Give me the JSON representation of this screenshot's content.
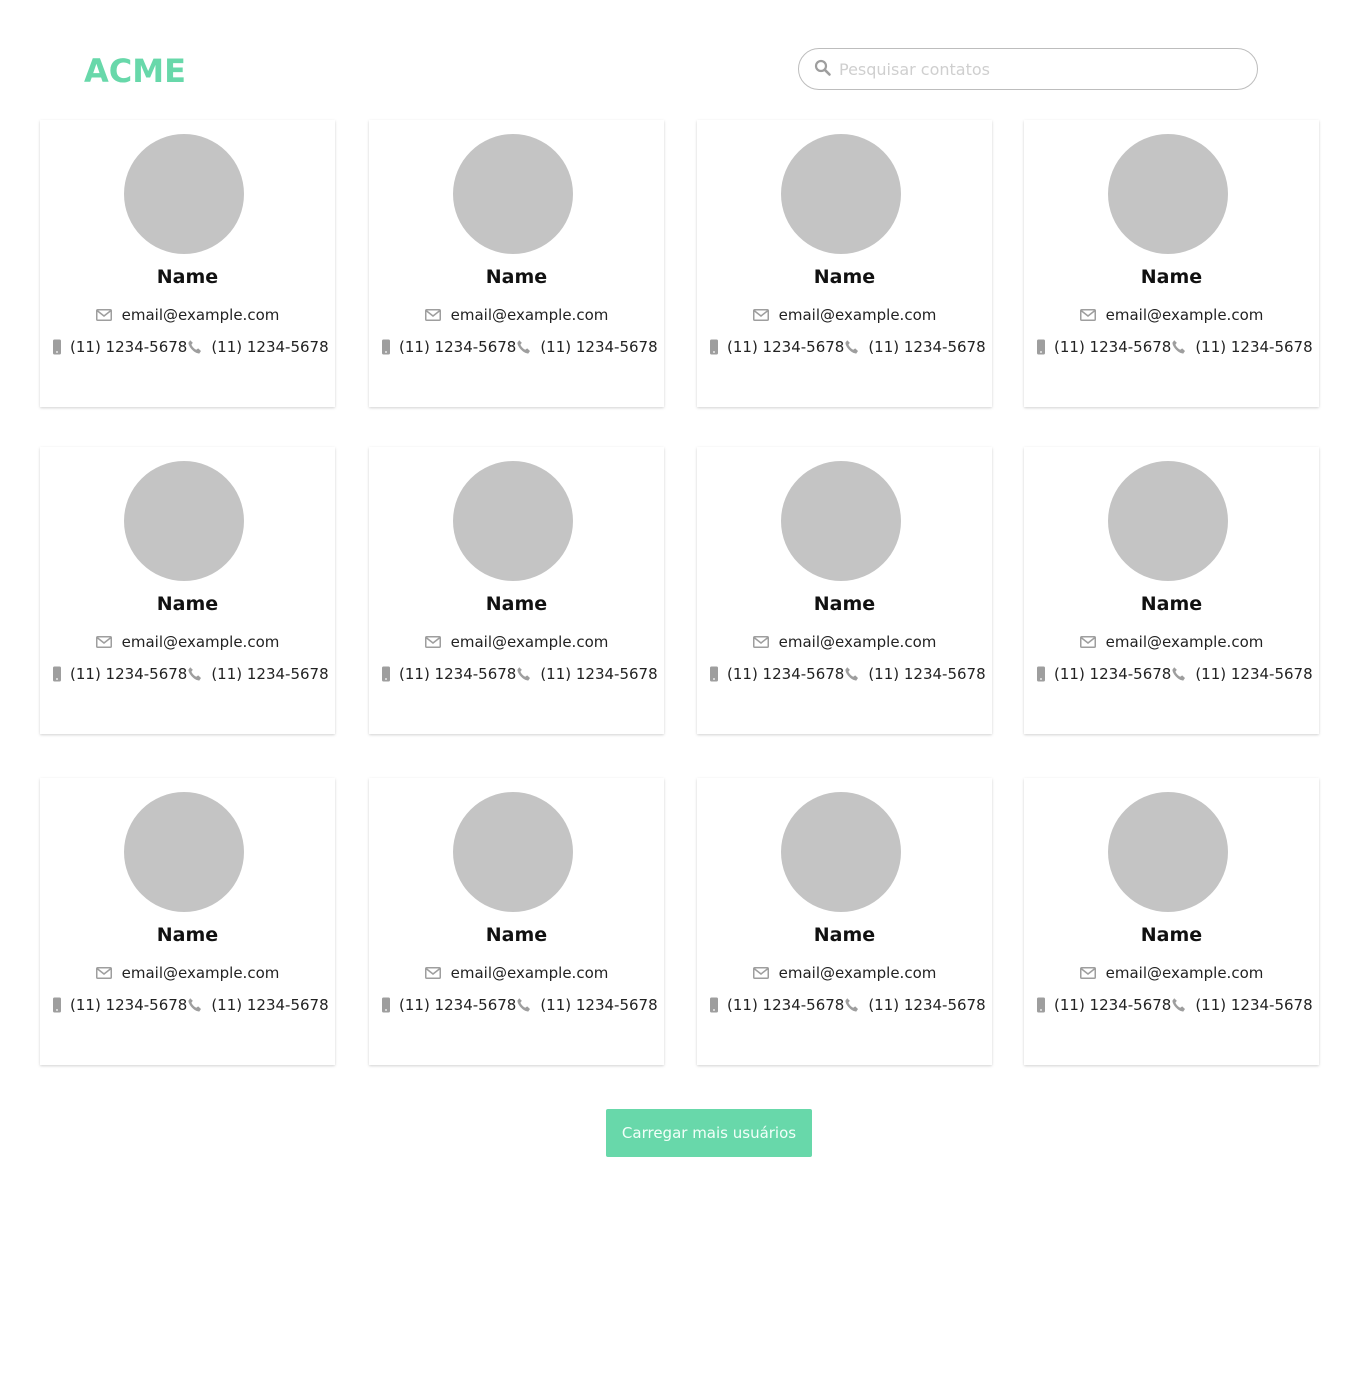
{
  "header": {
    "logo": "ACME",
    "search": {
      "placeholder": "Pesquisar contatos",
      "value": ""
    }
  },
  "contacts": [
    {
      "name": "Name",
      "email": "email@example.com",
      "mobile": "(11) 1234-5678",
      "phone": "(11) 1234-5678"
    },
    {
      "name": "Name",
      "email": "email@example.com",
      "mobile": "(11) 1234-5678",
      "phone": "(11) 1234-5678"
    },
    {
      "name": "Name",
      "email": "email@example.com",
      "mobile": "(11) 1234-5678",
      "phone": "(11) 1234-5678"
    },
    {
      "name": "Name",
      "email": "email@example.com",
      "mobile": "(11) 1234-5678",
      "phone": "(11) 1234-5678"
    },
    {
      "name": "Name",
      "email": "email@example.com",
      "mobile": "(11) 1234-5678",
      "phone": "(11) 1234-5678"
    },
    {
      "name": "Name",
      "email": "email@example.com",
      "mobile": "(11) 1234-5678",
      "phone": "(11) 1234-5678"
    },
    {
      "name": "Name",
      "email": "email@example.com",
      "mobile": "(11) 1234-5678",
      "phone": "(11) 1234-5678"
    },
    {
      "name": "Name",
      "email": "email@example.com",
      "mobile": "(11) 1234-5678",
      "phone": "(11) 1234-5678"
    },
    {
      "name": "Name",
      "email": "email@example.com",
      "mobile": "(11) 1234-5678",
      "phone": "(11) 1234-5678"
    },
    {
      "name": "Name",
      "email": "email@example.com",
      "mobile": "(11) 1234-5678",
      "phone": "(11) 1234-5678"
    },
    {
      "name": "Name",
      "email": "email@example.com",
      "mobile": "(11) 1234-5678",
      "phone": "(11) 1234-5678"
    },
    {
      "name": "Name",
      "email": "email@example.com",
      "mobile": "(11) 1234-5678",
      "phone": "(11) 1234-5678"
    }
  ],
  "icons": {
    "search": "search-icon",
    "email": "envelope-icon",
    "mobile": "mobile-phone-icon",
    "phone": "phone-handset-icon"
  },
  "colors": {
    "accent": "#68d8aa",
    "avatar_placeholder": "#c4c4c4",
    "icon_gray": "#9e9e9e"
  },
  "load_more_label": "Carregar mais usuários"
}
